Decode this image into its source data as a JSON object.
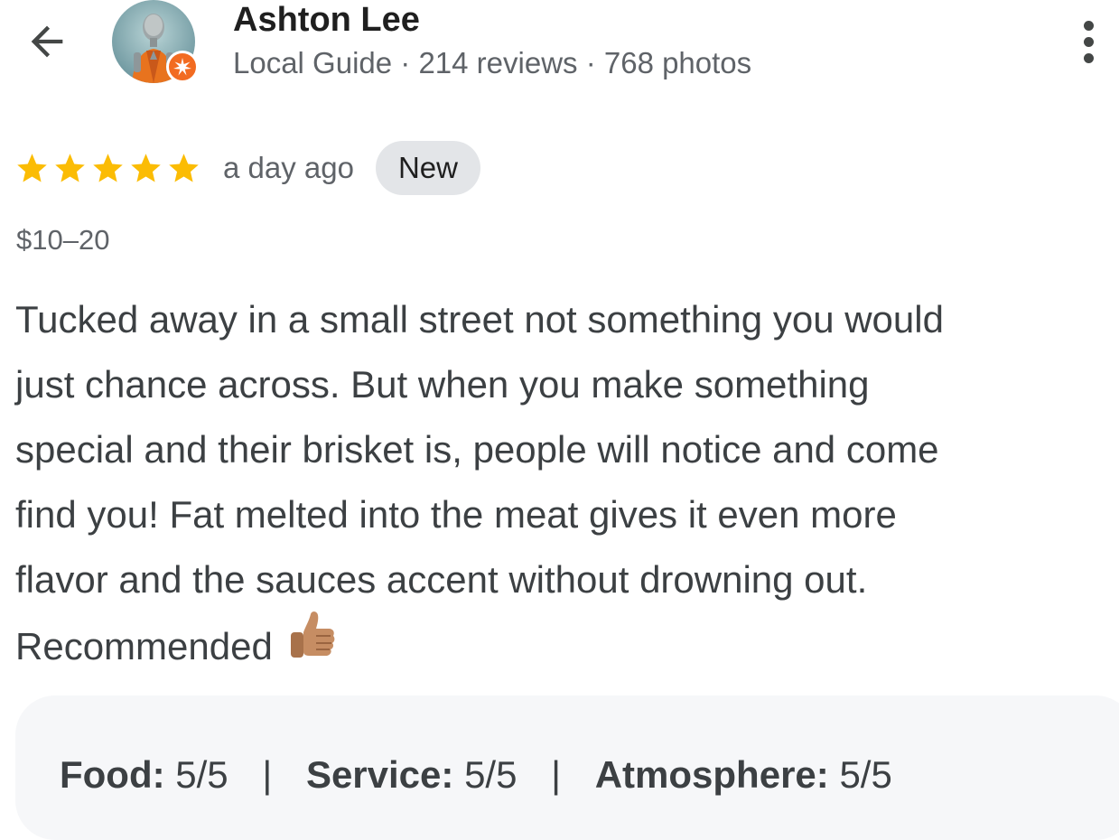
{
  "reviewer": {
    "name": "Ashton Lee",
    "meta": "Local Guide · 214 reviews · 768 photos",
    "badge_icon": "local-guide-badge-icon",
    "badge_color": "#f26b21"
  },
  "review": {
    "stars": 5,
    "star_color": "#fbbc04",
    "time_ago": "a day ago",
    "badge": "New",
    "price": "$10–20",
    "lines": [
      "Tucked away in a small street not something you would",
      "just chance across. But when you make something",
      "special and their brisket is, people will notice and come",
      "find you! Fat melted into the meat gives it even more",
      "flavor and the sauces accent without drowning out.",
      "Recommended"
    ],
    "emoji_icon": "thumbs-up-icon"
  },
  "ratings": {
    "food_label": "Food:",
    "food_value": "5/5",
    "service_label": "Service:",
    "service_value": "5/5",
    "atmosphere_label": "Atmosphere:",
    "atmosphere_value": "5/5",
    "separator": "|"
  },
  "icons": {
    "back": "arrow-back-icon",
    "more": "more-vert-icon"
  }
}
